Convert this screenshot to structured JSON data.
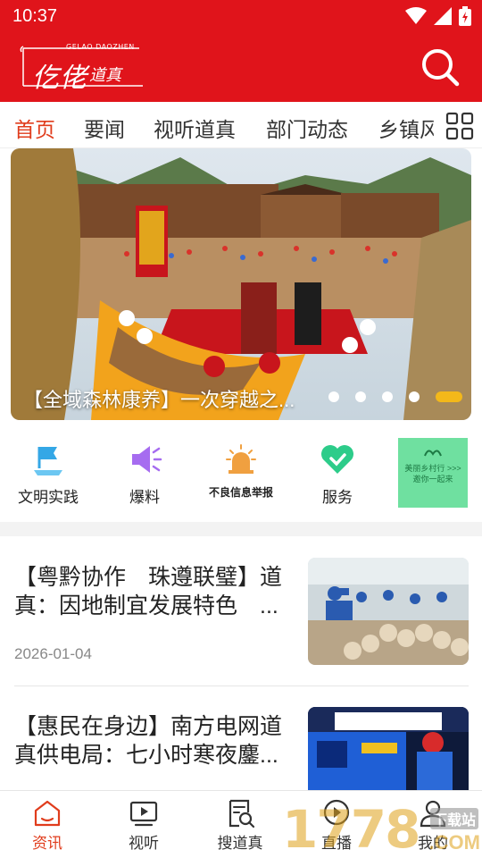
{
  "status_bar": {
    "time": "10:37",
    "icons": [
      "wifi-icon",
      "signal-icon",
      "battery-icon"
    ]
  },
  "header": {
    "logo_subtitle": "GELAO DAOZHEN",
    "logo_title_main": "仡佬",
    "logo_title_sub": "道真",
    "search_icon": "search-icon"
  },
  "tabs": {
    "items": [
      {
        "label": "首页",
        "active": true
      },
      {
        "label": "要闻",
        "active": false
      },
      {
        "label": "视听道真",
        "active": false
      },
      {
        "label": "部门动态",
        "active": false
      },
      {
        "label": "乡镇风",
        "active": false
      }
    ],
    "more_icon": "grid-icon"
  },
  "banner": {
    "caption": "【全域森林康养】一次穿越之...",
    "slide_count": 5,
    "active_slide": 5
  },
  "quick_links": [
    {
      "label": "文明实践",
      "icon": "flag-icon",
      "color": "#34a7e6"
    },
    {
      "label": "爆料",
      "icon": "megaphone-icon",
      "color": "#a66cf0"
    },
    {
      "label": "不良信息举报",
      "icon": "alarm-icon",
      "color": "#f0a040"
    },
    {
      "label": "服务",
      "icon": "heart-check-icon",
      "color": "#2dcc8a"
    }
  ],
  "promo": {
    "label": "美丽乡村行 >>> 邀你一起来"
  },
  "news": [
    {
      "title": "【粤黔协作　珠遵联璧】道真：因地制宜发展特色　...",
      "date": "2026-01-04"
    },
    {
      "title": "【惠民在身边】南方电网道真供电局：七小时寒夜鏖...",
      "date": ""
    }
  ],
  "bottom_nav": [
    {
      "label": "资讯",
      "icon": "home-icon",
      "active": true
    },
    {
      "label": "视听",
      "icon": "video-icon",
      "active": false
    },
    {
      "label": "搜道真",
      "icon": "search-doc-icon",
      "active": false
    },
    {
      "label": "直播",
      "icon": "play-circle-icon",
      "active": false
    },
    {
      "label": "我的",
      "icon": "user-icon",
      "active": false
    }
  ],
  "watermark": {
    "number": "1778",
    "tag": "下载站",
    "suffix": ".COM"
  },
  "colors": {
    "brand_red": "#e0141b",
    "active_tab": "#e03c1c",
    "dot_active": "#f3b81a"
  }
}
